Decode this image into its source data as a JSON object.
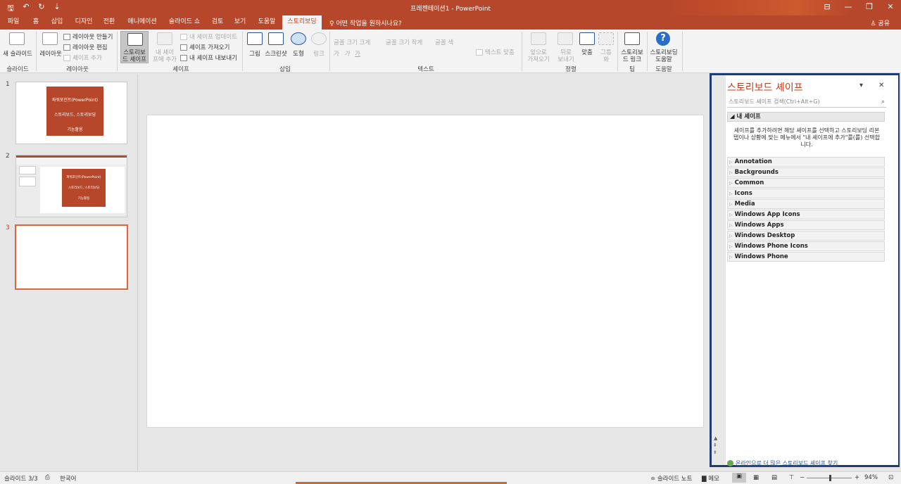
{
  "titlebar": {
    "doc_title": "프레젠테이션1  -  PowerPoint",
    "qat": {
      "save": "🖫",
      "undo": "↶",
      "redo": "↻",
      "customize": "⇣"
    },
    "window": {
      "ribbon_opts": "⊟",
      "minimize": "—",
      "restore": "❐",
      "close": "✕"
    }
  },
  "tabs": [
    {
      "label": "파일"
    },
    {
      "label": "홈"
    },
    {
      "label": "삽입"
    },
    {
      "label": "디자인"
    },
    {
      "label": "전환"
    },
    {
      "label": "애니메이션"
    },
    {
      "label": "슬라이드 쇼"
    },
    {
      "label": "검토"
    },
    {
      "label": "보기"
    },
    {
      "label": "도움말"
    },
    {
      "label": "스토리보딩"
    }
  ],
  "tellme": "♀ 어떤 작업을 원하시나요?",
  "share": "♙ 공유",
  "ribbon": {
    "slides": {
      "new_slide": "새 슬라이드",
      "group": "슬라이드"
    },
    "layouts": {
      "layout": "레이아웃",
      "make_layout": "레이아웃 만들기",
      "edit_layout": "레이아웃 편집",
      "add_shape": "셰이프 추가",
      "group": "레이아웃"
    },
    "shapes": {
      "storyboard_shapes_1": "스토리보",
      "storyboard_shapes_2": "드 셰이프",
      "my_shapes_1": "내 셰이",
      "my_shapes_2": "프에 추가",
      "update": "내 셰이프 업데이트",
      "import": "셰이프 가져오기",
      "export": "내 셰이프 내보내기",
      "group": "셰이프"
    },
    "insert": {
      "picture": "그림",
      "screenshot": "스크린샷",
      "shapes": "도형",
      "link": "링크",
      "group": "삽입"
    },
    "text": {
      "grow": "글꼴 크기 크게",
      "shrink": "글꼴 크기 작게",
      "color": "글꼴 색",
      "bold": "가",
      "italic": "가",
      "underline": "가",
      "fit": "텍스트 맞춤",
      "group": "텍스트"
    },
    "arrange": {
      "bring_fwd_1": "앞으로",
      "bring_fwd_2": "가져오기",
      "send_back_1": "뒤로",
      "send_back_2": "보내기",
      "align": "맞춤",
      "group_btn": "그룹",
      "group_btn_2": "화",
      "group": "정렬"
    },
    "link": {
      "sb_link_1": "스토리보",
      "sb_link_2": "드 링크",
      "group": "팁"
    },
    "help": {
      "sb_help_1": "스토리보딩",
      "sb_help_2": "도움말",
      "group": "도움말"
    }
  },
  "thumbnails": [
    {
      "num": "1",
      "line1": "파워포인트(PowerPoint)",
      "line2": "스토리보드, 스토리보딩",
      "line3": "기능활용"
    },
    {
      "num": "2",
      "line1": "파워포인트(PowerPoint)",
      "line2": "스토리보드, 스토리보딩",
      "line3": "기능활용"
    },
    {
      "num": "3"
    }
  ],
  "pane": {
    "title": "스토리보드 셰이프",
    "dropdown": "▾",
    "close": "✕",
    "search_placeholder": "스토리보드 셰이프 검색(Ctrl+Alt+G)",
    "search_icon": "⌕",
    "my_shapes": "◢ 내 셰이프",
    "description": "셰이프를 추가하려면 해당 셰이프를 선택하고 스토리보딩 리본 탭이나 상황에 맞는 메뉴에서 \"내 셰이프에 추가\"를(를) 선택합니다.",
    "categories": [
      "Annotation",
      "Backgrounds",
      "Common",
      "Icons",
      "Media",
      "Windows App Icons",
      "Windows Apps",
      "Windows Desktop",
      "Windows Phone Icons",
      "Windows Phone"
    ],
    "online_link": "온라인으로 더 많은 스토리보드 셰이프 찾기"
  },
  "status": {
    "slide_count": "슬라이드 3/3",
    "language": "한국어",
    "notes": "≐ 슬라이드 노트",
    "comments": "메모",
    "zoom": "94%",
    "zoom_minus": "−",
    "zoom_plus": "+"
  }
}
